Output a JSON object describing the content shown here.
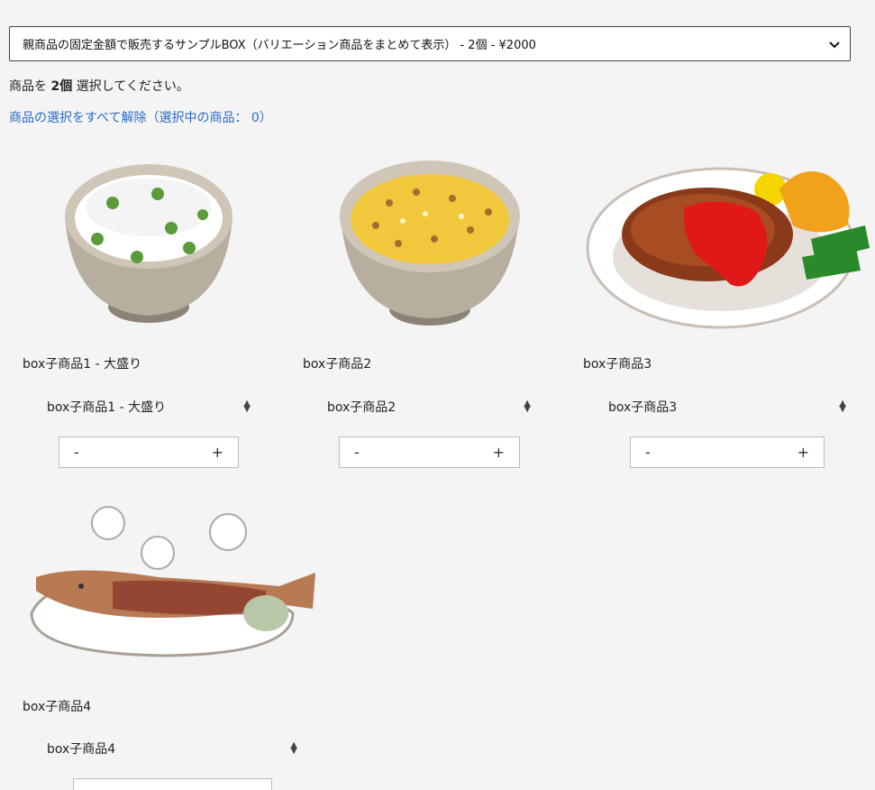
{
  "box_select": {
    "selected": "親商品の固定金額で販売するサンプルBOX（バリエーション商品をまとめて表示） - 2個 - ¥2000"
  },
  "instruction": {
    "prefix": "商品を",
    "count": "2個",
    "suffix": "選択してください。"
  },
  "clear_link": "商品の選択をすべて解除（選択中の商品： 0）",
  "products": [
    {
      "name": "box子商品1 - 大盛り",
      "variant": "box子商品1 - 大盛り",
      "minus": "-",
      "plus": "+",
      "image": "rice-bowl-with-peas"
    },
    {
      "name": "box子商品2",
      "variant": "box子商品2",
      "minus": "-",
      "plus": "+",
      "image": "fried-rice-bowl"
    },
    {
      "name": "box子商品3",
      "variant": "box子商品3",
      "minus": "-",
      "plus": "+",
      "image": "hamburg-steak-plate"
    },
    {
      "name": "box子商品4",
      "variant": "box子商品4",
      "minus": "-",
      "plus": "+",
      "image": "grilled-fish-plate"
    }
  ]
}
